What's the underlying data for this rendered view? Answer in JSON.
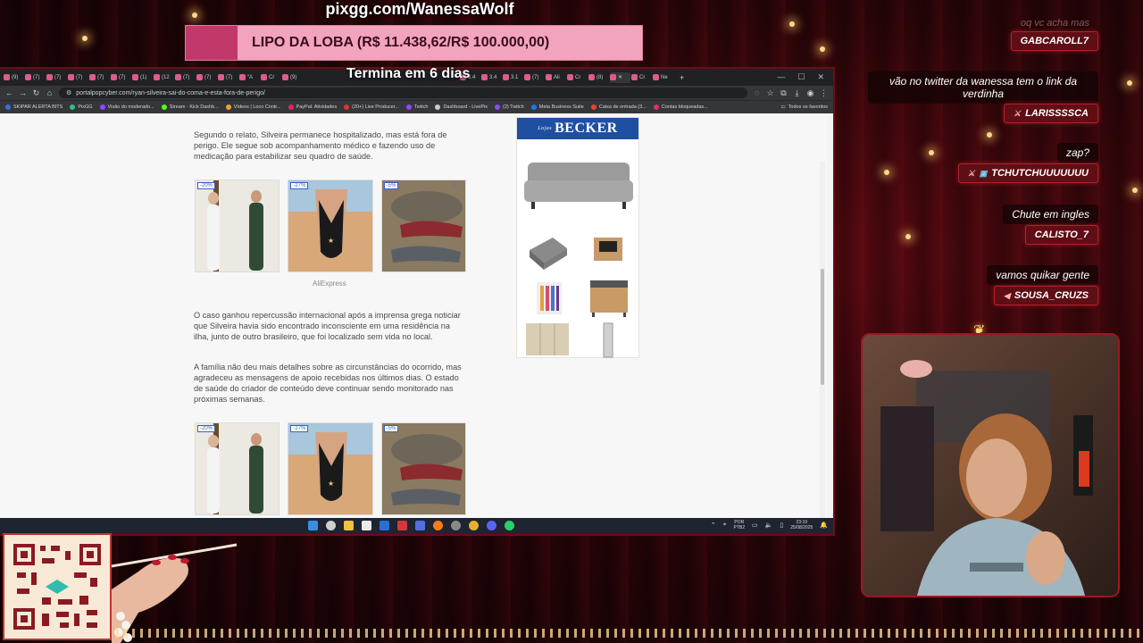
{
  "overlay": {
    "pix_url": "pixgg.com/WanessaWolf",
    "goal_text": "LIPO DA LOBA (R$ 11.438,62/R$ 100.000,00)",
    "goal_progress": 0.114,
    "deadline": "Termina em 6 dias"
  },
  "browser": {
    "tabs": [
      {
        "label": "(9)"
      },
      {
        "label": "(7)"
      },
      {
        "label": "(7)"
      },
      {
        "label": "(7)"
      },
      {
        "label": "(7)"
      },
      {
        "label": "(7)"
      },
      {
        "label": "(1)"
      },
      {
        "label": "(12"
      },
      {
        "label": "(7)"
      },
      {
        "label": "(7)"
      },
      {
        "label": "(7)"
      },
      {
        "label": "“A"
      },
      {
        "label": "Cr"
      },
      {
        "label": "(9)"
      }
    ],
    "tabs_right": [
      "3.4",
      "3.4",
      "3.1",
      "(7)",
      "Ali",
      "Cr",
      "(8)",
      "Cr",
      "Ne"
    ],
    "url": "portalpopcyber.com/ryan-silveira-sai-do-coma-e-esta-fora-de-perigo/",
    "bookmarks": [
      "SKIPAR ALERTA BITS",
      "PixGG",
      "Visão do moderado...",
      "Stream · Kick Dashb...",
      "Vídeos | Loco Contr...",
      "PayPal: Atividades",
      "(20+) Live Producer...",
      "Twitch",
      "Dashboard - LivePix",
      "(2) Twitch",
      "Meta Business Suite",
      "Caixa de entrada (3...",
      "Contas bloqueadas..."
    ],
    "bookmarks_folder": "Todos os favoritos"
  },
  "article": {
    "p1": "Segundo o relato, Silveira permanece hospitalizado, mas está fora de perigo. Ele segue sob acompanhamento médico e fazendo uso de medicação para estabilizar seu quadro de saúde.",
    "ad_label": "AliExpress",
    "ad_discounts": [
      "-20%",
      "-27%",
      "-5%"
    ],
    "p2": "O caso ganhou repercussão internacional após a imprensa grega noticiar que Silveira havia sido encontrado inconsciente em uma residência na ilha, junto de outro brasileiro, que foi localizado sem vida no local.",
    "p3": "A família não deu mais detalhes sobre as circunstâncias do ocorrido, mas agradeceu as mensagens de apoio recebidas nos últimos dias. O estado de saúde do criador de conteúdo deve continuar sendo monitorado nas próximas semanas."
  },
  "side_ad": {
    "brand_prefix": "Lojas",
    "brand": "BECKER"
  },
  "taskbar": {
    "lang": "POR",
    "lang2": "PTB2",
    "time": "23:19",
    "date": "25/08/2025"
  },
  "chat": [
    {
      "message": "oq vc acha mas",
      "user": "GABCAROLL7"
    },
    {
      "message": "vão no twitter da wanessa tem o link da verdinha",
      "user": "LARISSSSCA"
    },
    {
      "message": "zap?",
      "user": "TCHUTCHUUUUUUU"
    },
    {
      "message": "Chute em ingles",
      "user": "CALISTO_7"
    },
    {
      "message": "vamos quikar gente",
      "user": "SOUSA_CRUZS"
    }
  ],
  "colors": {
    "accent": "#c0396a",
    "goal_bg": "#f2a3bd",
    "chat_user_bg": "#5e0e14",
    "curtain": "#5a0a12"
  }
}
